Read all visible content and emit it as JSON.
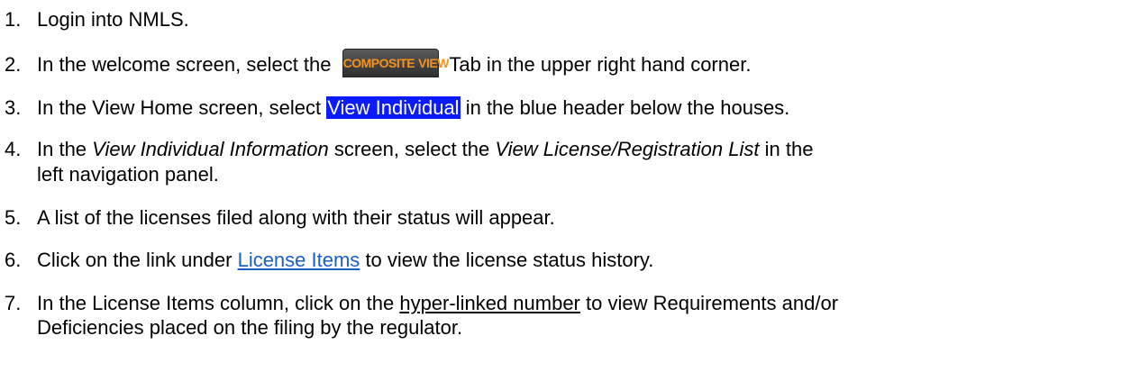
{
  "steps": [
    {
      "num": "1.",
      "text": "Login into NMLS."
    },
    {
      "num": "2.",
      "before": "In the welcome screen, select the",
      "after": "Tab in the upper right hand corner."
    },
    {
      "num": "3.",
      "before": "In the View Home screen, select",
      "highlight": "View Individual",
      "after": "in the blue header below the houses."
    },
    {
      "num": "4.",
      "p1": "In the",
      "em1": "View Individual Information",
      "p2": "screen, select the",
      "em2": "View License/Registration List",
      "p3": "in the",
      "line2": "left navigation panel."
    },
    {
      "num": "5.",
      "text": "A list of the licenses filed along with their status will appear."
    },
    {
      "num": "6.",
      "before": "Click on the link under",
      "link": "License Items",
      "after": "to view the license status history."
    },
    {
      "num": "7.",
      "before": "In the License Items column, click on the",
      "underline": "hyper-linked number",
      "after": "to view Requirements and/or",
      "line2": "Deficiencies placed on the filing by the regulator."
    }
  ],
  "tab_button": {
    "word1": "COMPOSITE",
    "word2": "VIEW"
  },
  "colors": {
    "highlight_bg": "#0a1bff",
    "highlight_text": "#ffffff",
    "link": "#1a5fc4",
    "tab_bg": "#3c3c3c",
    "tab_text_orange": "#f5921e"
  }
}
